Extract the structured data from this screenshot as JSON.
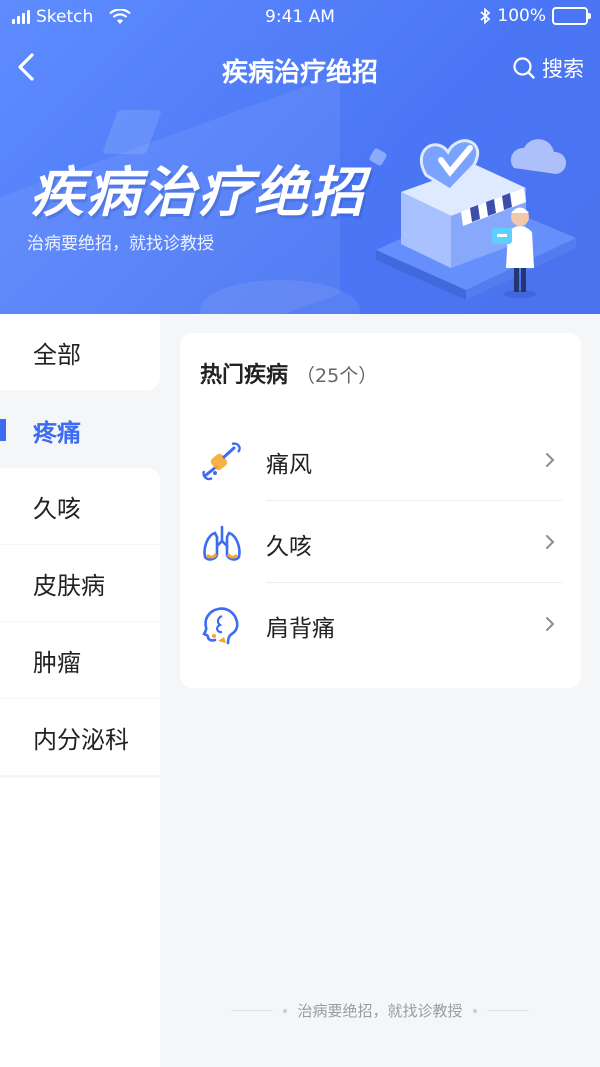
{
  "status_bar": {
    "carrier": "Sketch",
    "time": "9:41 AM",
    "battery": "100%"
  },
  "nav": {
    "title": "疾病治疗绝招",
    "search_label": "搜索"
  },
  "hero": {
    "title": "疾病治疗绝招",
    "subtitle": "治病要绝招，就找诊教授"
  },
  "sidebar": {
    "items": [
      {
        "label": "全部"
      },
      {
        "label": "疼痛"
      },
      {
        "label": "久咳"
      },
      {
        "label": "皮肤病"
      },
      {
        "label": "肿瘤"
      },
      {
        "label": "内分泌科"
      }
    ],
    "active": "疼痛"
  },
  "card": {
    "title": "热门疾病",
    "count": "（25个）",
    "items": [
      {
        "label": "痛风",
        "icon": "joint-icon"
      },
      {
        "label": "久咳",
        "icon": "lungs-icon"
      },
      {
        "label": "肩背痛",
        "icon": "head-profile-icon"
      }
    ]
  },
  "footer": {
    "text": "治病要绝招，就找诊教授"
  },
  "colors": {
    "primary": "#3d6cf2",
    "hero": "#5080f8",
    "accent_orange": "#f5a623"
  }
}
